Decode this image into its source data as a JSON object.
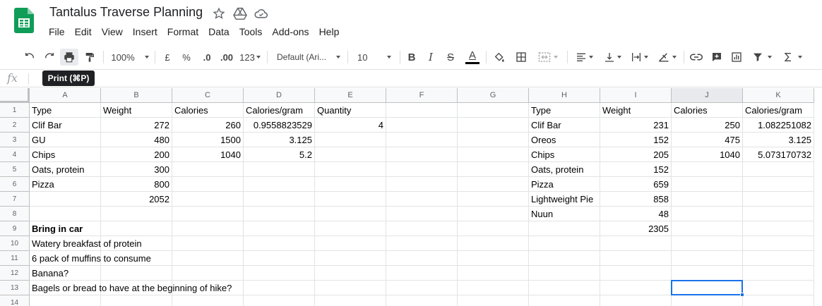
{
  "title": "Tantalus Traverse Planning",
  "menu": [
    "File",
    "Edit",
    "View",
    "Insert",
    "Format",
    "Data",
    "Tools",
    "Add-ons",
    "Help"
  ],
  "toolbar": {
    "zoom": "100%",
    "currency": "£",
    "percent": "%",
    "decrease_decimal": ".0",
    "increase_decimal": ".00",
    "more_formats": "123",
    "font": "Default (Ari...",
    "font_size": "10",
    "bold": "B",
    "italic": "I",
    "strike": "S",
    "text_color_letter": "A"
  },
  "tooltip": "Print (⌘P)",
  "formula_bar": {
    "fx_label": "fx",
    "value": ""
  },
  "columns": [
    "A",
    "B",
    "C",
    "D",
    "E",
    "F",
    "G",
    "H",
    "I",
    "J",
    "K"
  ],
  "selected_column": "J",
  "rows": [
    "1",
    "2",
    "3",
    "4",
    "5",
    "6",
    "7",
    "8",
    "9",
    "10",
    "11",
    "12",
    "13",
    "14"
  ],
  "cells": [
    [
      "Type",
      "Weight",
      "Calories",
      "Calories/gram",
      "Quantity",
      "",
      "",
      "Type",
      "Weight",
      "Calories",
      "Calories/gram"
    ],
    [
      "Clif Bar",
      "272",
      "260",
      "0.9558823529",
      "4",
      "",
      "",
      "Clif Bar",
      "231",
      "250",
      "1.082251082"
    ],
    [
      "GU",
      "480",
      "1500",
      "3.125",
      "",
      "",
      "",
      "Oreos",
      "152",
      "475",
      "3.125"
    ],
    [
      "Chips",
      "200",
      "1040",
      "5.2",
      "",
      "",
      "",
      "Chips",
      "205",
      "1040",
      "5.073170732"
    ],
    [
      "Oats, protein",
      "300",
      "",
      "",
      "",
      "",
      "",
      "Oats, protein",
      "152",
      "",
      ""
    ],
    [
      "Pizza",
      "800",
      "",
      "",
      "",
      "",
      "",
      "Pizza",
      "659",
      "",
      ""
    ],
    [
      "",
      "2052",
      "",
      "",
      "",
      "",
      "",
      "Lightweight Pie",
      "858",
      "",
      ""
    ],
    [
      "",
      "",
      "",
      "",
      "",
      "",
      "",
      "Nuun",
      "48",
      "",
      ""
    ],
    [
      "Bring in car",
      "",
      "",
      "",
      "",
      "",
      "",
      "",
      "2305",
      "",
      ""
    ],
    [
      "Watery breakfast of protein",
      "",
      "",
      "",
      "",
      "",
      "",
      "",
      "",
      "",
      ""
    ],
    [
      "6 pack of muffins to consume",
      "",
      "",
      "",
      "",
      "",
      "",
      "",
      "",
      "",
      ""
    ],
    [
      "Banana?",
      "",
      "",
      "",
      "",
      "",
      "",
      "",
      "",
      "",
      ""
    ],
    [
      "Bagels or bread to have at the beginning of hike?",
      "",
      "",
      "",
      "",
      "",
      "",
      "",
      "",
      "",
      ""
    ],
    [
      "",
      "",
      "",
      "",
      "",
      "",
      "",
      "",
      "",
      "",
      ""
    ]
  ],
  "selected_cell": "J13",
  "colors": {
    "accent": "#1a73e8",
    "sheets_green": "#0f9d58"
  }
}
